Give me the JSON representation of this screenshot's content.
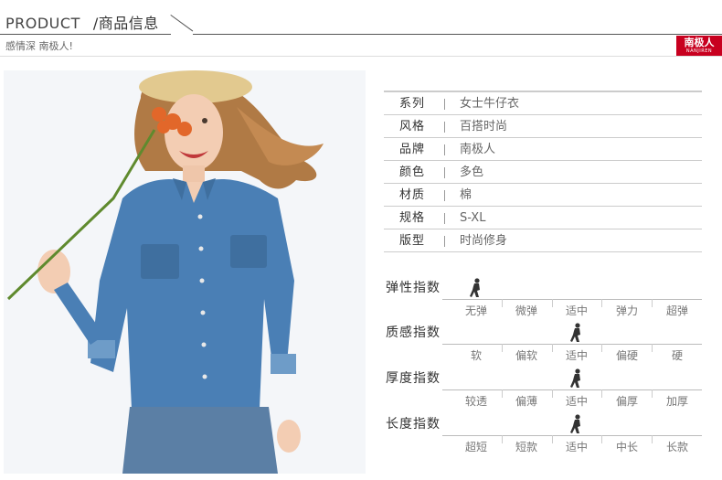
{
  "header": {
    "title_en": "PRODUCT",
    "title_cn": "/商品信息",
    "subtitle": "感情深 南极人!",
    "logo_cn": "南极人",
    "logo_en": "NANJIREN"
  },
  "product_photo": {
    "alt": "model-in-denim-shirt"
  },
  "specs": [
    {
      "key": "系列",
      "value": "女士牛仔衣"
    },
    {
      "key": "风格",
      "value": "百搭时尚"
    },
    {
      "key": "品牌",
      "value": "南极人"
    },
    {
      "key": "颜色",
      "value": "多色"
    },
    {
      "key": "材质",
      "value": "棉"
    },
    {
      "key": "规格",
      "value": "S-XL"
    },
    {
      "key": "版型",
      "value": "时尚修身"
    }
  ],
  "indices": [
    {
      "title": "弹性指数",
      "labels": [
        "无弹",
        "微弹",
        "适中",
        "弹力",
        "超弹"
      ],
      "selected": 0
    },
    {
      "title": "质感指数",
      "labels": [
        "软",
        "偏软",
        "适中",
        "偏硬",
        "硬"
      ],
      "selected": 2
    },
    {
      "title": "厚度指数",
      "labels": [
        "较透",
        "偏薄",
        "适中",
        "偏厚",
        "加厚"
      ],
      "selected": 2
    },
    {
      "title": "长度指数",
      "labels": [
        "超短",
        "短款",
        "适中",
        "中长",
        "长款"
      ],
      "selected": 2
    }
  ],
  "colors": {
    "brand_red": "#c8001f",
    "denim": "#4a7fb5",
    "rule": "#cccccc"
  }
}
